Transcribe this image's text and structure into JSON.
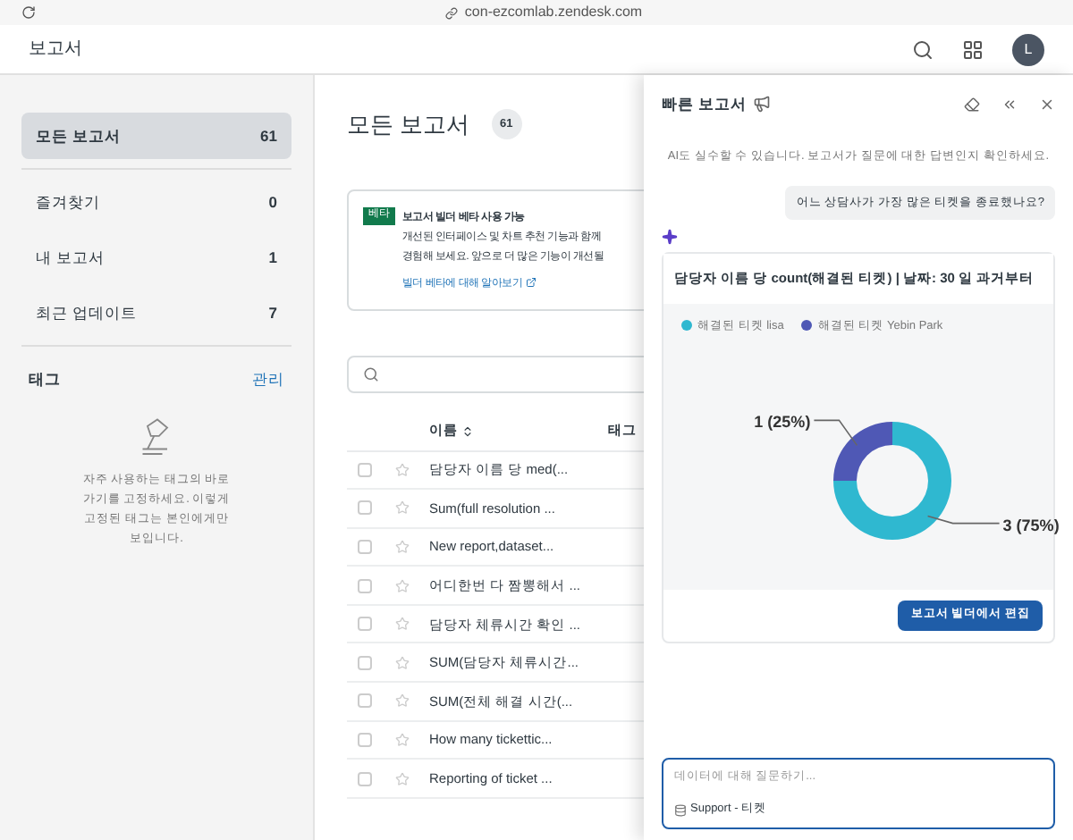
{
  "browser": {
    "url": "con-ezcomlab.zendesk.com"
  },
  "header": {
    "title": "보고서",
    "avatar": "L"
  },
  "sidebar": {
    "items": [
      {
        "label": "모든 보고서",
        "count": "61",
        "selected": true
      },
      {
        "label": "즐겨찾기",
        "count": "0",
        "selected": false
      },
      {
        "label": "내 보고서",
        "count": "1",
        "selected": false
      },
      {
        "label": "최근 업데이트",
        "count": "7",
        "selected": false
      }
    ],
    "tags": {
      "title": "태그",
      "manage": "관리",
      "empty": "자주 사용하는 태그의 바로 가기를 고정하세요. 이렇게 고정된 태그는 본인에게만 보입니다."
    }
  },
  "main": {
    "title": "모든 보고서",
    "count": "61",
    "banner": {
      "badge": "베타",
      "title": "보고서 빌더 베타 사용 가능",
      "lines": [
        "개선된 인터페이스 및 차트 추천 기능과 함께",
        "경험해 보세요. 앞으로 더 많은 기능이 개선될"
      ],
      "link": "빌더 베타에 대해 알아보기"
    },
    "table": {
      "columns": [
        "이름",
        "태그"
      ],
      "rows": [
        {
          "name": "담당자 이름 당 med(...",
          "checked": false,
          "starred": false
        },
        {
          "name": "Sum(full resolution ...",
          "checked": false,
          "starred": false
        },
        {
          "name": "New report,dataset...",
          "checked": false,
          "starred": false
        },
        {
          "name": "어디한번 다 짬뽕해서 ...",
          "checked": false,
          "starred": false
        },
        {
          "name": "담당자 체류시간 확인 ...",
          "checked": false,
          "starred": false
        },
        {
          "name": "SUM(담당자 체류시간...",
          "checked": false,
          "starred": false
        },
        {
          "name": "SUM(전체 해결 시간(...",
          "checked": false,
          "starred": false
        },
        {
          "name": "How many tickettic...",
          "checked": false,
          "starred": false
        },
        {
          "name": "Reporting of ticket ...",
          "checked": false,
          "starred": false
        }
      ]
    }
  },
  "panel": {
    "title": "빠른 보고서",
    "disclaimer": "AI도 실수할 수 있습니다. 보고서가 질문에 대한 답변인지 확인하세요.",
    "question": "어느 상담사가 가장 많은 티켓을 종료했나요?",
    "card": {
      "title": "담당자 이름 당 count(해결된 티켓) | 날짜: 30 일 과거부터",
      "chart_data": {
        "type": "donut",
        "categories": [
          "해결된 티켓 lisa",
          "해결된 티켓 Yebin Park"
        ],
        "values": [
          75,
          25
        ],
        "colors": [
          "#2fb8d0",
          "#4f58b5"
        ],
        "value_labels": [
          "3 (75%)",
          "1 (25%)"
        ]
      },
      "button": "보고서 빌더에서 편집"
    },
    "input": {
      "placeholder": "데이터에 대해 질문하기...",
      "source": "Support - 티켓"
    }
  }
}
